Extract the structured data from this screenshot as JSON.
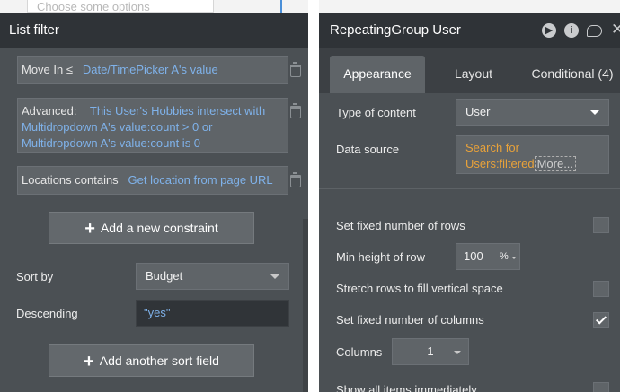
{
  "background": {
    "placeholder_text": "Choose some options"
  },
  "list_filter": {
    "title": "List filter",
    "constraints": [
      {
        "label": "Move In ≤",
        "value": "Date/TimePicker A's value"
      },
      {
        "label": "Advanced:",
        "value": "This User's Hobbies intersect with Multidropdown A's value:count > 0 or Multidropdown A's value:count is 0"
      },
      {
        "label": "Locations contains",
        "value": "Get location from page URL"
      }
    ],
    "add_constraint_label": "Add a new constraint",
    "sort_by_label": "Sort by",
    "sort_by_value": "Budget",
    "descending_label": "Descending",
    "descending_value": "\"yes\"",
    "add_sort_label": "Add another sort field"
  },
  "repeating_group": {
    "title": "RepeatingGroup User",
    "tabs": [
      {
        "label": "Appearance",
        "active": true
      },
      {
        "label": "Layout",
        "active": false
      },
      {
        "label": "Conditional (4)",
        "active": false
      }
    ],
    "type_of_content_label": "Type of content",
    "type_of_content_value": "User",
    "data_source_label": "Data source",
    "data_source_value_line1": "Search for",
    "data_source_value_line2": "Users:filtered",
    "data_source_more": "More...",
    "fixed_rows_label": "Set fixed number of rows",
    "fixed_rows_checked": false,
    "min_height_label": "Min height of row",
    "min_height_value": "100",
    "min_height_unit": "%",
    "stretch_label": "Stretch rows to fill vertical space",
    "stretch_checked": false,
    "fixed_cols_label": "Set fixed number of columns",
    "fixed_cols_checked": true,
    "columns_label": "Columns",
    "columns_value": "1",
    "show_all_label": "Show all items immediately",
    "header_icons": [
      "play-icon",
      "info-icon",
      "comment-icon",
      "close-icon"
    ]
  },
  "colors": {
    "panel_bg": "#4b5054",
    "header_bg": "#2f3337",
    "dynamic_blue": "#7fb2ea",
    "dynamic_orange": "#e8a23a"
  }
}
